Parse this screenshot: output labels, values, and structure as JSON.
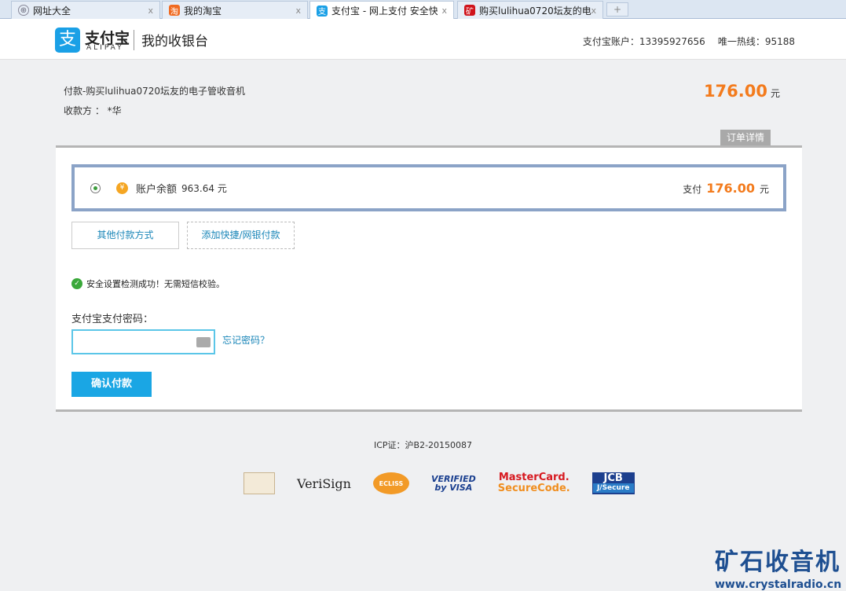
{
  "browser": {
    "tabs": [
      {
        "label": "网址大全",
        "icon": "globe-icon"
      },
      {
        "label": "我的淘宝",
        "icon": "taobao-icon"
      },
      {
        "label": "支付宝 - 网上支付 安全快",
        "icon": "alipay-icon"
      },
      {
        "label": "购买lulihua0720坛友的电",
        "icon": "kuang-icon"
      }
    ],
    "new_tab": "+",
    "close": "x"
  },
  "header": {
    "logo_cn": "支付宝",
    "logo_en": "ALIPAY",
    "logo_glyph": "支",
    "title": "我的收银台",
    "account_label": "支付宝账户：13395927656",
    "hotline_label": "唯一热线：95188"
  },
  "order": {
    "title": "付款-购买lulihua0720坛友的电子管收音机",
    "payee": "收款方 ： *华",
    "amount": "176.00",
    "currency": "元",
    "detail_button": "订单详情"
  },
  "payment": {
    "balance_label": "账户余额",
    "balance_value": "963.64 元",
    "pay_label": "支付",
    "pay_amount": "176.00",
    "pay_currency": "元",
    "other_methods": "其他付款方式",
    "add_card": "添加快捷/网银付款"
  },
  "security": {
    "message": "安全设置检测成功！无需短信校验。"
  },
  "password": {
    "label": "支付宝支付密码：",
    "value": "",
    "forgot": "忘记密码？"
  },
  "confirm_button": "确认付款",
  "footer": {
    "icp": "ICP证：沪B2-20150087",
    "badges": [
      "VeriSign",
      "VERIFIED",
      "by VISA",
      "MasterCard.",
      "SecureCode.",
      "JCB",
      "J/Secure",
      "ECLISS"
    ]
  },
  "watermark": {
    "title": "矿石收音机",
    "url": "www.crystalradio.cn"
  }
}
